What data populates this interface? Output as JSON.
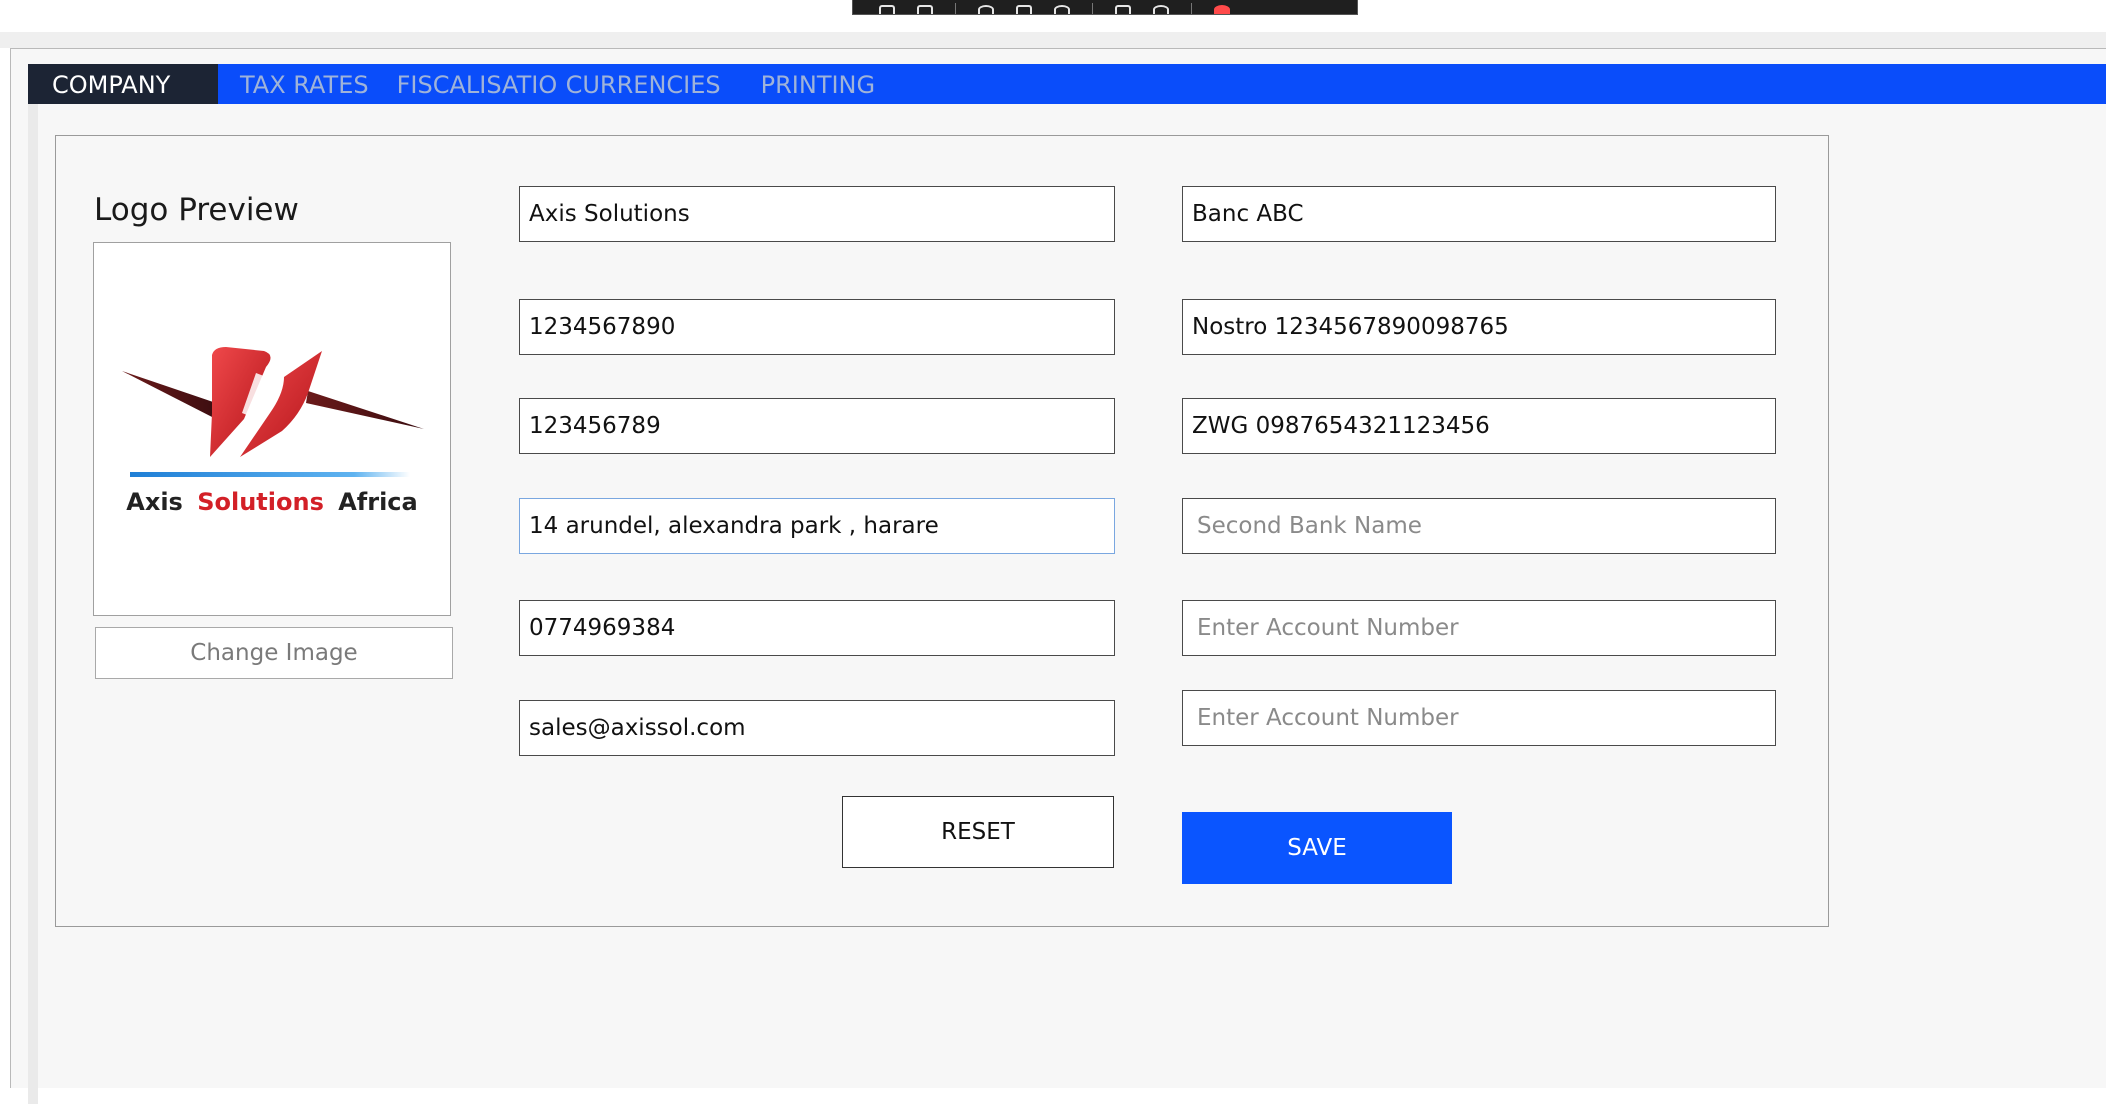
{
  "toolbar": {
    "icons": [
      "crop-icon",
      "camera-icon",
      "pin-icon",
      "window-icon",
      "pin-alt-icon",
      "car-icon",
      "info-icon",
      "record-icon"
    ],
    "record_color": "#ff4a4a"
  },
  "tabs": [
    {
      "label": "COMPANY",
      "active": true
    },
    {
      "label": "TAX RATES",
      "active": false
    },
    {
      "label": "FISCALISATIO",
      "active": false
    },
    {
      "label": "CURRENCIES",
      "active": false
    },
    {
      "label": "PRINTING",
      "active": false
    }
  ],
  "logo": {
    "label": "Logo Preview",
    "brand_word1": "Axis",
    "brand_word2": "Solutions",
    "brand_word3": "Africa",
    "change_label": "Change Image"
  },
  "company": {
    "name": "Axis Solutions",
    "field2": "1234567890",
    "field3": "123456789",
    "address": "14 arundel, alexandra park , harare",
    "phone": "0774969384",
    "email": "sales@axissol.com"
  },
  "bank": {
    "name": "Banc ABC",
    "account1": "Nostro 1234567890098765",
    "account2": "ZWG 0987654321123456",
    "second_name_placeholder": "Second Bank Name",
    "account_placeholder_1": "Enter Account Number",
    "account_placeholder_2": "Enter Account Number"
  },
  "buttons": {
    "reset": "RESET",
    "save": "SAVE"
  },
  "colors": {
    "tab_bar": "#0a4dfa",
    "active_tab": "#1c2434",
    "save_button": "#0a55ff"
  }
}
